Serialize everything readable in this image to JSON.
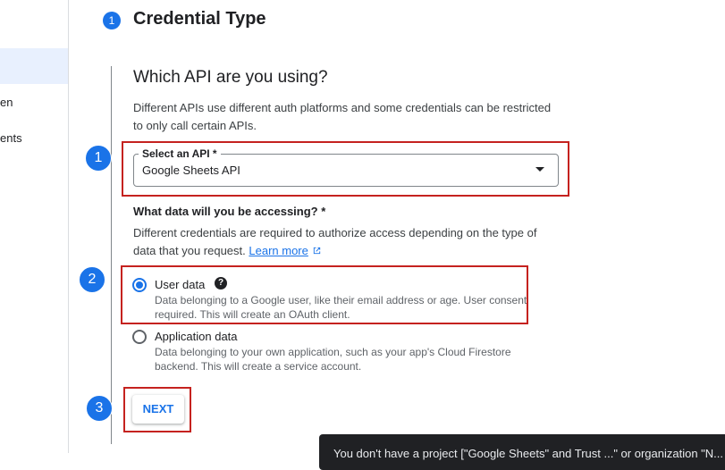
{
  "sidebar": {
    "items": [
      {
        "label": "en"
      },
      {
        "label": "ents"
      }
    ]
  },
  "step": {
    "number": "1",
    "title": "Credential Type"
  },
  "section": {
    "heading": "Which API are you using?",
    "description": "Different APIs use different auth platforms and some credentials can be restricted to only call certain APIs."
  },
  "api_select": {
    "label": "Select an API *",
    "value": "Google Sheets API"
  },
  "data_question": {
    "label": "What data will you be accessing? *",
    "description": "Different credentials are required to authorize access depending on the type of data that you request.",
    "link_text": "Learn more"
  },
  "options": [
    {
      "label": "User data",
      "description": "Data belonging to a Google user, like their email address or age. User consent required. This will create an OAuth client.",
      "selected": true
    },
    {
      "label": "Application data",
      "description": "Data belonging to your own application, such as your app's Cloud Firestore backend. This will create a service account.",
      "selected": false
    }
  ],
  "next_button": {
    "label": "NEXT"
  },
  "annotations": {
    "badges": [
      "1",
      "2",
      "3"
    ],
    "highlight_color": "#c5221f",
    "badge_color": "#1a73e8"
  },
  "snackbar": {
    "text": "You don't have a project [\"Google Sheets\" and Trust ...\" or organization \"N..."
  },
  "icons": {
    "help": "help-circle-icon",
    "external_link": "open-in-new-icon",
    "dropdown": "arrow-drop-down-icon"
  }
}
